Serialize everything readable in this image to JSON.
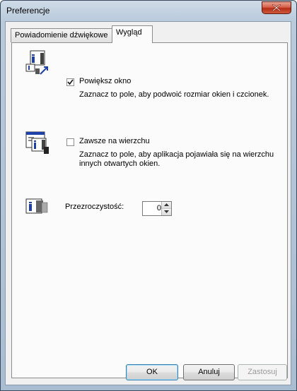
{
  "window": {
    "title": "Preferencje"
  },
  "tabs": [
    {
      "label": "Powiadomienie dźwiękowe",
      "selected": false
    },
    {
      "label": "Wygląd",
      "selected": true
    }
  ],
  "options": [
    {
      "label": "Powiększ okno",
      "checked": true,
      "description": "Zaznacz to pole, aby podwoić rozmiar okien i czcionek.",
      "icon": "enlarge-window-icon"
    },
    {
      "label": "Zawsze na wierzchu",
      "checked": false,
      "description_line1": "Zaznacz to pole, aby aplikacja pojawiała się na wierzchu",
      "description_line2": "innych otwartych okien.",
      "icon": "always-on-top-icon"
    }
  ],
  "transparency": {
    "label": "Przezroczystość:",
    "value": "0",
    "icon": "transparency-icon"
  },
  "buttons": {
    "ok": "OK",
    "cancel": "Anuluj",
    "apply": "Zastosuj"
  }
}
